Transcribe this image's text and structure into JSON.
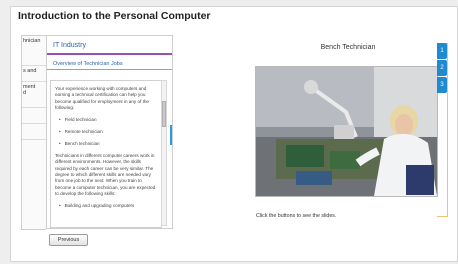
{
  "course": {
    "title": "Introduction to the Personal Computer"
  },
  "nav": {
    "items": [
      "hnician",
      "s and",
      "ment\nd",
      "",
      ""
    ]
  },
  "panel": {
    "header": "IT Industry",
    "subheader": "Overview of Technician Jobs",
    "intro": "Your experience working with computers and earning a technical certification can help you become qualified for employment in any of the following:",
    "bullets": [
      "Field technician",
      "Remote technician",
      "Bench technician"
    ],
    "body": "Technicians in different computer careers work in different environments. However, the skills required by each career can be very similar. The degree to which different skills are needed vary from one job to the next. When you train to become a computer technician, you are expected to develop the following skills:",
    "bullet_tail": "Building and upgrading computers"
  },
  "content": {
    "title": "Bench Technician",
    "caption": "Click the buttons to see the slides."
  },
  "slides": {
    "tabs": [
      "1",
      "2",
      "3"
    ]
  },
  "footer": {
    "previous_label": "Previous"
  },
  "colors": {
    "accent": "#1f8ad0",
    "purple_rule": "#9b4fb0",
    "header_text": "#2c62b0"
  }
}
